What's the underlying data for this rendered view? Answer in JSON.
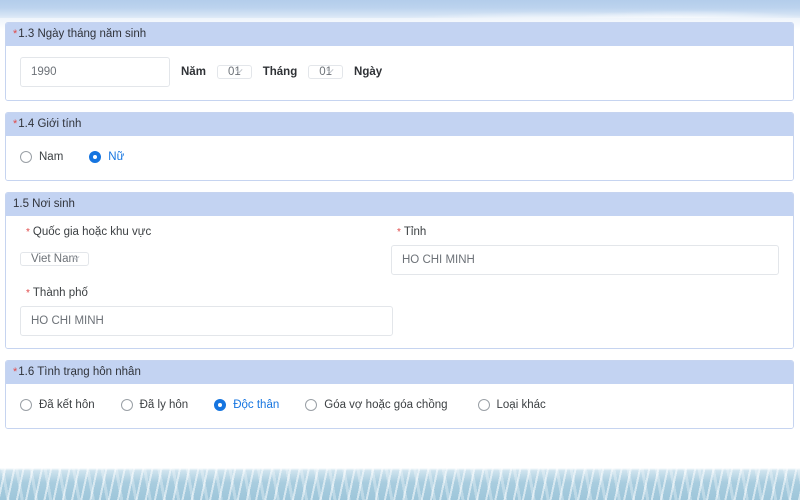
{
  "sections": [
    {
      "id": "birth-date",
      "required": true,
      "title": "1.3 Ngày tháng năm sinh",
      "fields": {
        "year_value": "1990",
        "year_unit": "Năm",
        "month_value": "01",
        "month_unit": "Tháng",
        "day_value": "01",
        "day_unit": "Ngày"
      }
    },
    {
      "id": "gender",
      "required": true,
      "title": "1.4 Giới tính",
      "options": [
        {
          "label": "Nam",
          "selected": false
        },
        {
          "label": "Nữ",
          "selected": true
        }
      ]
    },
    {
      "id": "birth-place",
      "required": false,
      "title": "1.5 Nơi sinh",
      "fields": {
        "country_label": "Quốc gia hoặc khu vực",
        "country_value": "Viet Nam",
        "province_label": "Tỉnh",
        "province_value": "HO CHI MINH",
        "city_label": "Thành phố",
        "city_value": "HO CHI MINH"
      }
    },
    {
      "id": "marital-status",
      "required": true,
      "title": "1.6 Tình trạng hôn nhân",
      "options": [
        {
          "label": "Đã kết hôn",
          "selected": false
        },
        {
          "label": "Đã ly hôn",
          "selected": false
        },
        {
          "label": "Độc thân",
          "selected": true
        },
        {
          "label": "Góa vợ hoặc góa chồng",
          "selected": false
        },
        {
          "label": "Loại khác",
          "selected": false
        }
      ]
    }
  ],
  "icons": {
    "chevron_down": "chevron-down-icon",
    "required_marker": "*"
  },
  "colors": {
    "header_band": "#c3d3f2",
    "panel_border": "#c6d4f0",
    "accent_blue": "#1675e0",
    "required_red": "#e04a4a",
    "input_border": "#e3e6ea",
    "input_text": "#6d7278",
    "sky": "#bcd3ee",
    "water": "#a9cddf"
  }
}
